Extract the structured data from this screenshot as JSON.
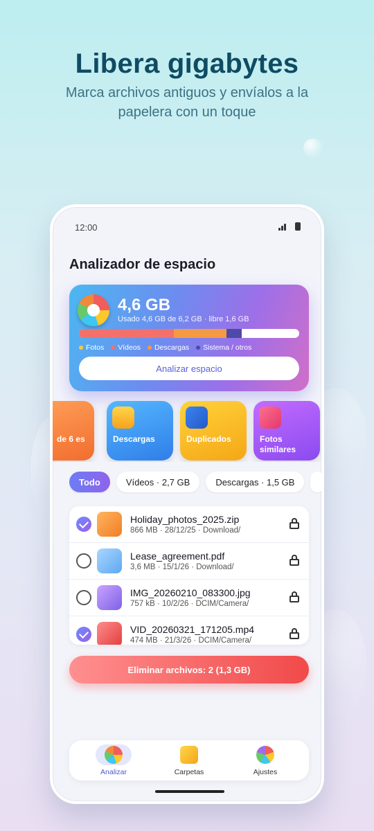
{
  "hero": {
    "title": "Libera gigabytes",
    "subtitle": "Marca archivos antiguos y envíalos a la papelera con un toque"
  },
  "status_bar": {
    "time": "12:00",
    "icons": [
      "signal-icon",
      "battery-icon"
    ]
  },
  "app": {
    "title": "Analizador de espacio",
    "storage": {
      "total_free": "4,6 GB",
      "usage_line": "Usado 4,6 GB de 6,2 GB · libre 1,6 GB",
      "segments": [
        {
          "name": "Fotos",
          "color": "#ffc83a",
          "fraction": 0.0
        },
        {
          "name": "Vídeos",
          "color": "#f4706a",
          "fraction": 0.43
        },
        {
          "name": "Descargas",
          "color": "#f59a43",
          "fraction": 0.24
        },
        {
          "name": "Sistema / otros",
          "color": "#4d4aa8",
          "fraction": 0.07
        }
      ],
      "legend": [
        "Fotos",
        "Vídeos",
        "Descargas",
        "Sistema / otros"
      ],
      "analyze_label": "Analizar espacio"
    },
    "categories": [
      {
        "label": "de 6 es",
        "icon": "large-files-icon",
        "partial": true
      },
      {
        "label": "Descargas",
        "icon": "download-icon"
      },
      {
        "label": "Duplicados",
        "icon": "duplicates-icon"
      },
      {
        "label": "Fotos similares",
        "icon": "similar-photos-icon"
      }
    ],
    "filters": [
      {
        "label": "Todo",
        "active": true
      },
      {
        "label": "Vídeos · 2,7 GB",
        "active": false
      },
      {
        "label": "Descargas · 1,5 GB",
        "active": false
      }
    ],
    "files": [
      {
        "name": "Holiday_photos_2025.zip",
        "meta": "866 MB · 28/12/25 · Download/",
        "checked": true,
        "icon": "archive-icon"
      },
      {
        "name": "Lease_agreement.pdf",
        "meta": "3,6 MB · 15/1/26 · Download/",
        "checked": false,
        "icon": "document-icon"
      },
      {
        "name": "IMG_20260210_083300.jpg",
        "meta": "757 kB · 10/2/26 · DCIM/Camera/",
        "checked": false,
        "icon": "image-icon"
      },
      {
        "name": "VID_20260321_171205.mp4",
        "meta": "474 MB · 21/3/26 · DCIM/Camera/",
        "checked": true,
        "icon": "video-icon"
      }
    ],
    "delete_label": "Eliminar archivos: 2 (1,3 GB)",
    "nav": [
      {
        "label": "Analizar",
        "icon": "analyze-icon",
        "active": true
      },
      {
        "label": "Carpetas",
        "icon": "folders-icon",
        "active": false
      },
      {
        "label": "Ajustes",
        "icon": "settings-icon",
        "active": false
      }
    ]
  }
}
